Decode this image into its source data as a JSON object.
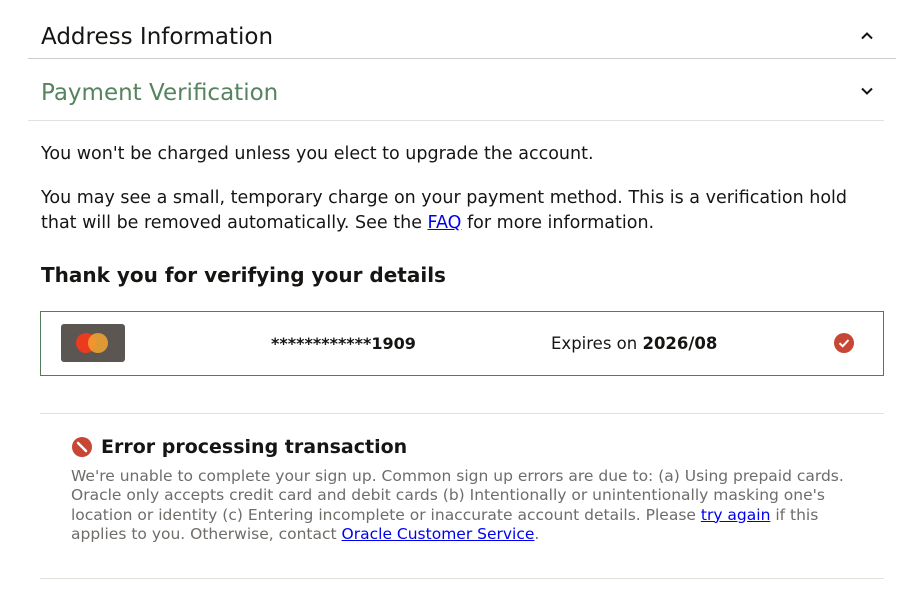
{
  "address_section": {
    "title": "Address Information",
    "state": "expanded"
  },
  "payment_section": {
    "title": "Payment Verification",
    "state": "collapsed",
    "title_color": "#55845f",
    "para1": "You won't be charged unless you elect to upgrade the account.",
    "para2_before": "You may see a small, temporary charge on your payment method. This is a verification hold that will be removed automatically. See the ",
    "para2_link": "FAQ",
    "para2_after": " for more information.",
    "thanks_heading": "Thank you for verifying your details",
    "card": {
      "brand_icon": "mastercard-logo",
      "masked_number": "************1909",
      "expires_label": "Expires on ",
      "expires_value": "2026/08",
      "status_icon": "check-circle-icon",
      "border_color": "#4f7d5a"
    }
  },
  "error": {
    "icon": "error-circle-icon",
    "title": "Error processing transaction",
    "body_before": "We're unable to complete your sign up. Common sign up errors are due to: (a) Using prepaid cards. Oracle only accepts credit card and debit cards (b) Intentionally or unintentionally masking one's location or identity (c) Entering incomplete or inaccurate account details. Please ",
    "try_again_link": "try again",
    "body_middle": " if this applies to you. Otherwise, contact ",
    "customer_service_link": "Oracle Customer Service",
    "body_after": ".",
    "icon_color": "#c74634"
  }
}
